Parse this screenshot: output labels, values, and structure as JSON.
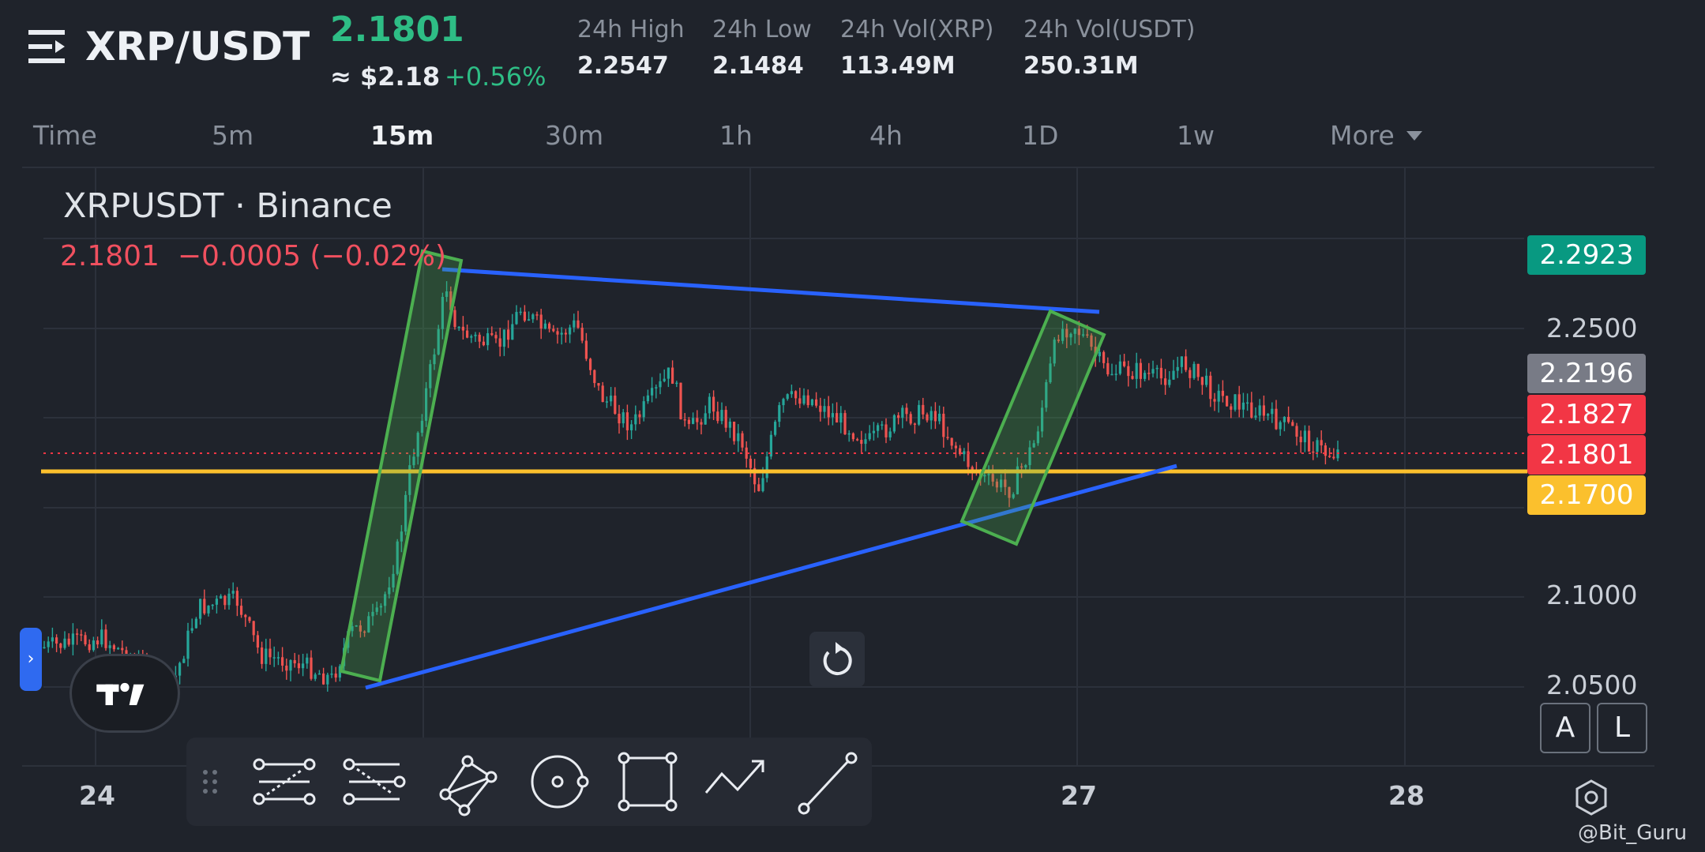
{
  "header": {
    "pair": "XRP/USDT",
    "last_price": "2.1801",
    "usd_price": "≈ $2.18",
    "change_pct": "+0.56%",
    "stats": [
      {
        "label": "24h High",
        "value": "2.2547"
      },
      {
        "label": "24h Low",
        "value": "2.1484"
      },
      {
        "label": "24h Vol(XRP)",
        "value": "113.49M"
      },
      {
        "label": "24h Vol(USDT)",
        "value": "250.31M"
      }
    ]
  },
  "timeframes": [
    "Time",
    "5m",
    "15m",
    "30m",
    "1h",
    "4h",
    "1D",
    "1w",
    "More"
  ],
  "active_timeframe": "15m",
  "chart": {
    "symbol": "XRPUSDT · Binance",
    "ohlc_line": "2.1801  −0.0005 (−0.02%)",
    "y_axis_labels": [
      "2.2500",
      "2.1000",
      "2.0500"
    ],
    "price_badges": [
      {
        "value": "2.2923",
        "color": "#089981"
      },
      {
        "value": "2.2196",
        "color": "#787b86"
      },
      {
        "value": "2.1827",
        "color": "#f23645"
      },
      {
        "value": "2.1801",
        "color": "#f23645"
      },
      {
        "value": "2.1700",
        "color": "#fbc02d"
      }
    ],
    "x_axis_labels": [
      "24",
      "27",
      "28"
    ],
    "horizontal_level": 2.17,
    "colors": {
      "up": "#26a69a",
      "down": "#ef5350",
      "trendline": "#2962ff",
      "level": "#fbc02d",
      "highlight": "#4caf50"
    }
  },
  "toolbar": {
    "tools": [
      "drag-handle",
      "fib-retracement",
      "fib-extension",
      "xabcd-pattern",
      "circle",
      "rectangle",
      "path",
      "trend-line"
    ],
    "right_buttons": [
      "A",
      "L"
    ]
  },
  "watermark": "@Bit_Guru"
}
